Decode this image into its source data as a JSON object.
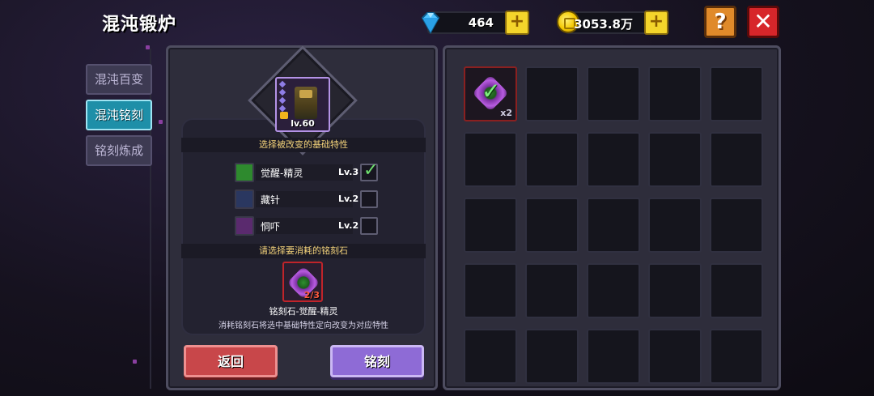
{
  "header": {
    "title": "混沌锻炉",
    "gems": "464",
    "gold": "3053.8万",
    "help_label": "?",
    "close_label": "✕"
  },
  "tabs": [
    {
      "label": "混沌百变",
      "active": false
    },
    {
      "label": "混沌铭刻",
      "active": true
    },
    {
      "label": "铭刻炼成",
      "active": false
    }
  ],
  "equipment": {
    "level": "lv.60"
  },
  "traits_section": {
    "heading": "选择被改变的基础特性",
    "traits": [
      {
        "name": "觉醒-精灵",
        "level": "Lv.3",
        "checked": true,
        "icon": "green-awaken-icon"
      },
      {
        "name": "藏针",
        "level": "Lv.2",
        "checked": false,
        "icon": "hidden-needle-icon"
      },
      {
        "name": "恫吓",
        "level": "Lv.2",
        "checked": false,
        "icon": "intimidate-icon"
      }
    ]
  },
  "rune_section": {
    "heading": "请选择要消耗的铭刻石",
    "count": "2/3",
    "name": "铭刻石-觉醒-精灵",
    "description": "消耗铭刻石将选中基础特性定向改变为对应特性"
  },
  "buttons": {
    "back": "返回",
    "engrave": "铭刻"
  },
  "inventory": {
    "cells": [
      {
        "filled": true,
        "qty": "x2"
      },
      {
        "filled": false,
        "qty": ""
      },
      {
        "filled": false,
        "qty": ""
      },
      {
        "filled": false,
        "qty": ""
      },
      {
        "filled": false,
        "qty": ""
      },
      {
        "filled": false,
        "qty": ""
      },
      {
        "filled": false,
        "qty": ""
      },
      {
        "filled": false,
        "qty": ""
      },
      {
        "filled": false,
        "qty": ""
      },
      {
        "filled": false,
        "qty": ""
      },
      {
        "filled": false,
        "qty": ""
      },
      {
        "filled": false,
        "qty": ""
      },
      {
        "filled": false,
        "qty": ""
      },
      {
        "filled": false,
        "qty": ""
      },
      {
        "filled": false,
        "qty": ""
      },
      {
        "filled": false,
        "qty": ""
      },
      {
        "filled": false,
        "qty": ""
      },
      {
        "filled": false,
        "qty": ""
      },
      {
        "filled": false,
        "qty": ""
      },
      {
        "filled": false,
        "qty": ""
      },
      {
        "filled": false,
        "qty": ""
      },
      {
        "filled": false,
        "qty": ""
      },
      {
        "filled": false,
        "qty": ""
      },
      {
        "filled": false,
        "qty": ""
      },
      {
        "filled": false,
        "qty": ""
      }
    ]
  },
  "colors": {
    "active_tab": "#1e8fa8",
    "back_button": "#c8474a",
    "engrave_button": "#8e6bd6",
    "selected_check": "#6ee06e"
  }
}
